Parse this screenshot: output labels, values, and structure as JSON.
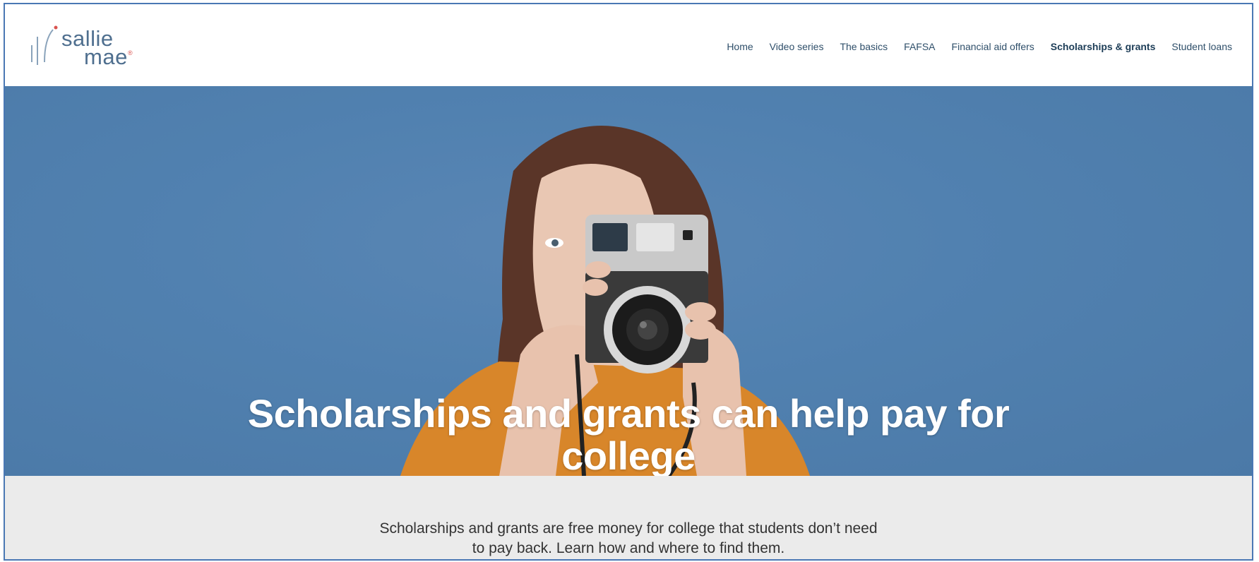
{
  "logo": {
    "line1": "sallie",
    "line2": "mae",
    "mark": "®"
  },
  "nav": {
    "items": [
      {
        "label": "Home"
      },
      {
        "label": "Video series"
      },
      {
        "label": "The basics"
      },
      {
        "label": "FAFSA"
      },
      {
        "label": "Financial aid offers"
      },
      {
        "label": "Scholarships & grants",
        "active": true
      },
      {
        "label": "Student loans"
      }
    ]
  },
  "hero": {
    "title": "Scholarships and grants can help pay for college",
    "image": "woman-holding-camera-photo"
  },
  "intro": {
    "text": "Scholarships and grants are free money for college that students don’t need to pay back. Learn how and where to find them."
  },
  "colors": {
    "brand": "#4f6f8f",
    "hero_bg": "#5181b0",
    "intro_bg": "#ebebeb",
    "accent_red": "#d9534f"
  }
}
